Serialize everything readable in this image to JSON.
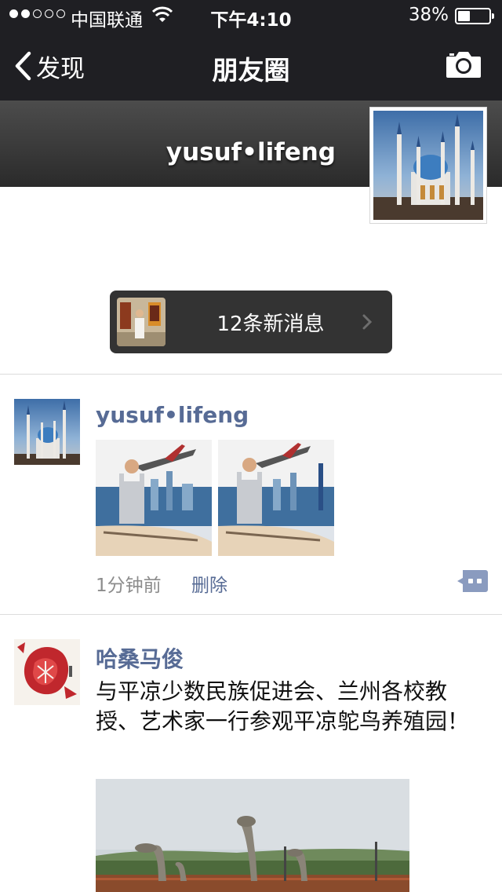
{
  "status_bar": {
    "carrier": "中国联通",
    "time": "下午4:10",
    "battery": "38%",
    "battery_level": 0.38,
    "signal_bars": 2
  },
  "nav": {
    "back_label": "发现",
    "title": "朋友圈"
  },
  "profile": {
    "username": "yusuf•lifeng"
  },
  "new_messages": {
    "label": "12条新消息"
  },
  "posts": [
    {
      "author": "yusuf•lifeng",
      "time": "1分钟前",
      "delete_label": "删除",
      "image_count": 2
    },
    {
      "author": "哈桑马俊",
      "text": "与平凉少数民族促进会、兰州各校教授、艺术家一行参观平凉鸵鸟养殖园！"
    }
  ],
  "colors": {
    "bar_bg": "#1f1f23",
    "link_blue": "#576b95",
    "pill_bg": "#333333"
  },
  "icons": [
    "chevron-left-icon",
    "camera-icon",
    "wifi-icon",
    "battery-icon",
    "chevron-right-icon",
    "comment-icon"
  ]
}
